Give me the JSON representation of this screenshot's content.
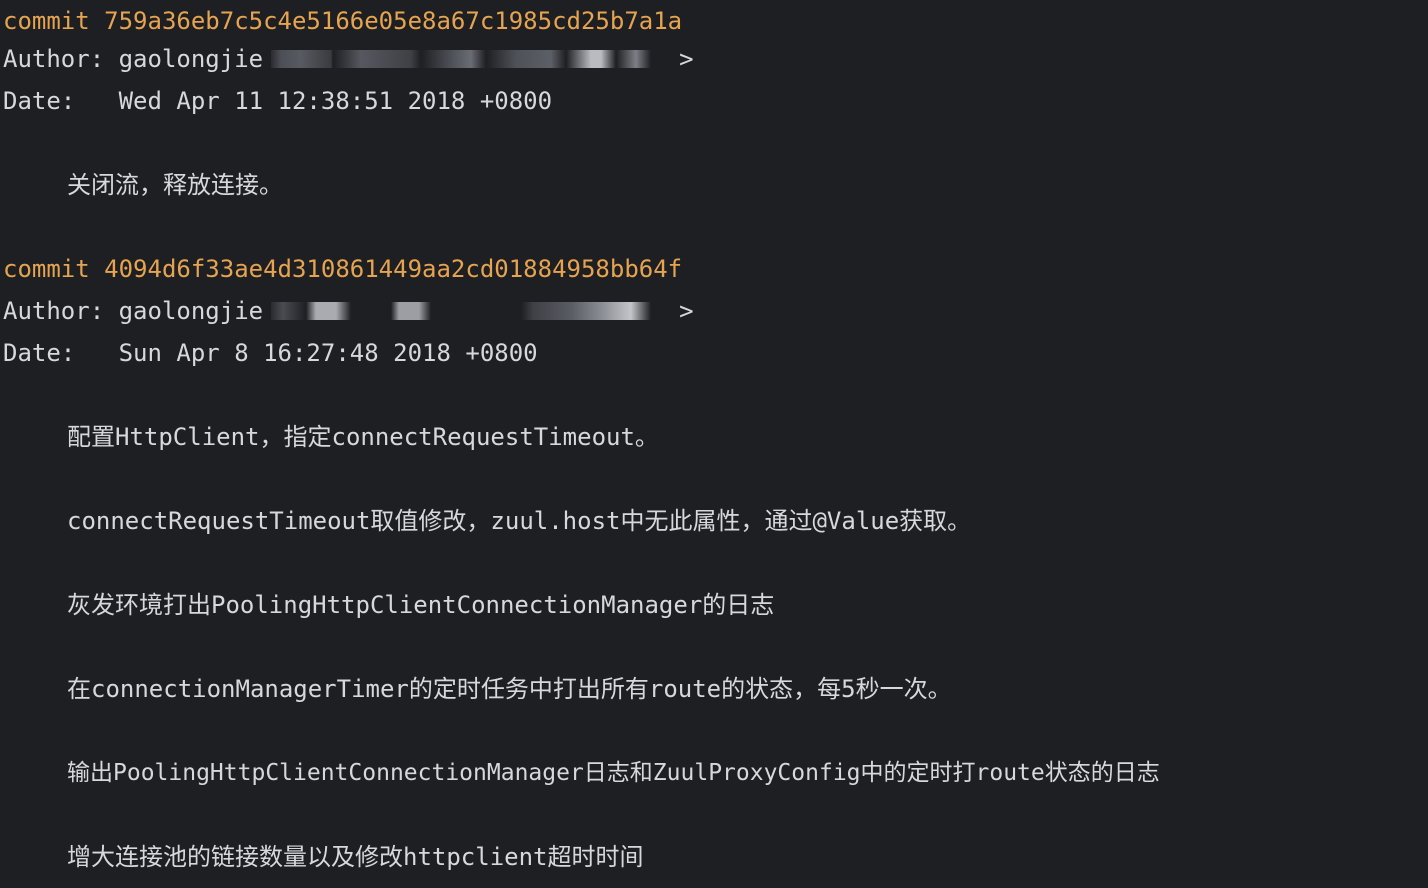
{
  "commits": [
    {
      "commit_line": "commit 759a36eb7c5c4e5166e05e8a67c1985cd25b7a1a",
      "author_label": "Author: gaolongjie",
      "author_close": ">",
      "date_line": "Date:   Wed Apr 11 12:38:51 2018 +0800",
      "messages": [
        "关闭流，释放连接。"
      ]
    },
    {
      "commit_line": "commit 4094d6f33ae4d310861449aa2cd01884958bb64f",
      "author_label": "Author: gaolongjie",
      "author_close": ">",
      "date_line": "Date:   Sun Apr 8 16:27:48 2018 +0800",
      "messages": [
        "配置HttpClient，指定connectRequestTimeout。",
        "connectRequestTimeout取值修改，zuul.host中无此属性，通过@Value获取。",
        "灰发环境打出PoolingHttpClientConnectionManager的日志",
        "在connectionManagerTimer的定时任务中打出所有route的状态，每5秒一次。",
        "输出PoolingHttpClientConnectionManager日志和ZuulProxyConfig中的定时打route状态的日志",
        "增大连接池的链接数量以及修改httpclient超时时间"
      ]
    }
  ],
  "colors": {
    "background": "#1e1f22",
    "text": "#d6d8dc",
    "commit_hash": "#e6a451"
  }
}
